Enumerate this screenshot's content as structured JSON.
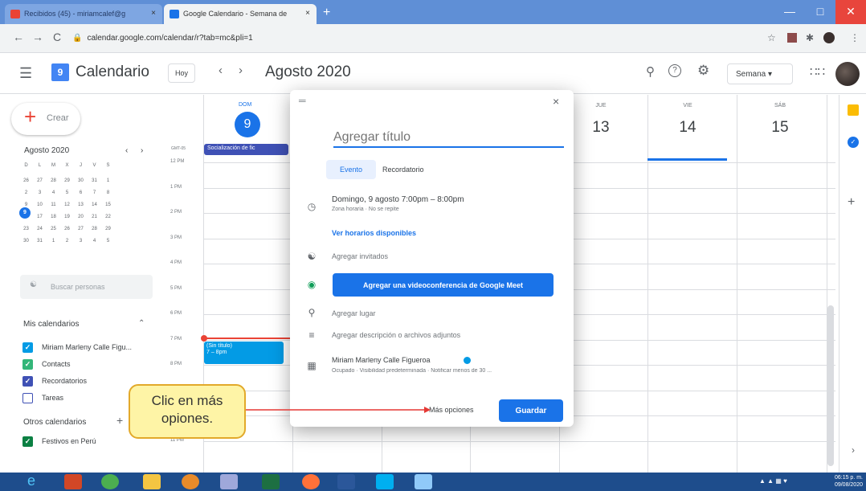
{
  "browser": {
    "tabs": [
      {
        "label": "Recibidos (45) - miriamcalef@g",
        "close": "×"
      },
      {
        "label": "Google Calendario - Semana de",
        "close": "×"
      }
    ],
    "new_tab": "+",
    "url": "calendar.google.com/calendar/r?tab=mc&pli=1",
    "nav": {
      "back": "←",
      "forward": "→",
      "reload": "C"
    }
  },
  "header": {
    "logo_day": "9",
    "app_title": "Calendario",
    "today_label": "Hoy",
    "prev": "‹",
    "next": "›",
    "period": "Agosto 2020",
    "view_selector": "Semana ▾"
  },
  "sidebar": {
    "create_label": "Crear",
    "mini_month": "Agosto 2020",
    "mini_prev": "‹",
    "mini_next": "›",
    "mini_weekdays": [
      "D",
      "L",
      "M",
      "X",
      "J",
      "V",
      "S"
    ],
    "mini_weeks": [
      [
        "26",
        "27",
        "28",
        "29",
        "30",
        "31",
        "1"
      ],
      [
        "2",
        "3",
        "4",
        "5",
        "6",
        "7",
        "8"
      ],
      [
        "9",
        "10",
        "11",
        "12",
        "13",
        "14",
        "15"
      ],
      [
        "16",
        "17",
        "18",
        "19",
        "20",
        "21",
        "22"
      ],
      [
        "23",
        "24",
        "25",
        "26",
        "27",
        "28",
        "29"
      ],
      [
        "30",
        "31",
        "1",
        "2",
        "3",
        "4",
        "5"
      ]
    ],
    "selected_day": "9",
    "search_people": "Buscar personas",
    "my_calendars": "Mis calendarios",
    "calendars": [
      {
        "label": "Miriam Marleny Calle Figu...",
        "color": "#039be5",
        "checked": true
      },
      {
        "label": "Contacts",
        "color": "#33b679",
        "checked": true
      },
      {
        "label": "Recordatorios",
        "color": "#3f51b5",
        "checked": true
      },
      {
        "label": "Tareas",
        "color": "#3f51b5",
        "checked": false
      }
    ],
    "other_calendars": "Otros calendarios",
    "other_add": "+",
    "other": [
      {
        "label": "Festivos en Perú",
        "color": "#0b8043",
        "checked": true
      }
    ]
  },
  "grid": {
    "timezone": "GMT-05",
    "days": [
      {
        "label": "DOM",
        "num": "9"
      },
      {
        "label": "JUE",
        "num": "13"
      },
      {
        "label": "VIE",
        "num": "14"
      },
      {
        "label": "SÁB",
        "num": "15"
      }
    ],
    "times": [
      "12 PM",
      "1 PM",
      "2 PM",
      "3 PM",
      "4 PM",
      "5 PM",
      "6 PM",
      "7 PM",
      "8 PM",
      "9 PM",
      "10 PM",
      "11 PM"
    ],
    "allday_event": "Socialización de fic",
    "event": {
      "title": "(Sin título)",
      "time": "7 – 8pm"
    }
  },
  "dialog": {
    "drag": "═",
    "close": "×",
    "title_placeholder": "Agregar título",
    "tab_event": "Evento",
    "tab_reminder": "Recordatorio",
    "datetime": "Domingo, 9 agosto   7:00pm  –  8:00pm",
    "timezone_note": "Zona horaria · No se repite",
    "availability": "Ver horarios disponibles",
    "guests": "Agregar invitados",
    "meet_button": "Agregar una videoconferencia de Google Meet",
    "location": "Agregar lugar",
    "description": "Agregar descripción o archivos adjuntos",
    "owner": "Miriam Marleny Calle Figueroa",
    "owner_details": "Ocupado · Visibilidad predeterminada · Notificar menos de 30 ...",
    "more_options": "Más opciones",
    "save": "Guardar"
  },
  "callout": {
    "line1": "Clic en más",
    "line2": "opiones."
  },
  "taskbar": {
    "time": "06:15 p. m.",
    "date": "09/08/2020"
  },
  "colors": {
    "accent": "#1a73e8",
    "event": "#039be5",
    "now": "#ea4335",
    "callout_fill": "#fef4a6"
  }
}
